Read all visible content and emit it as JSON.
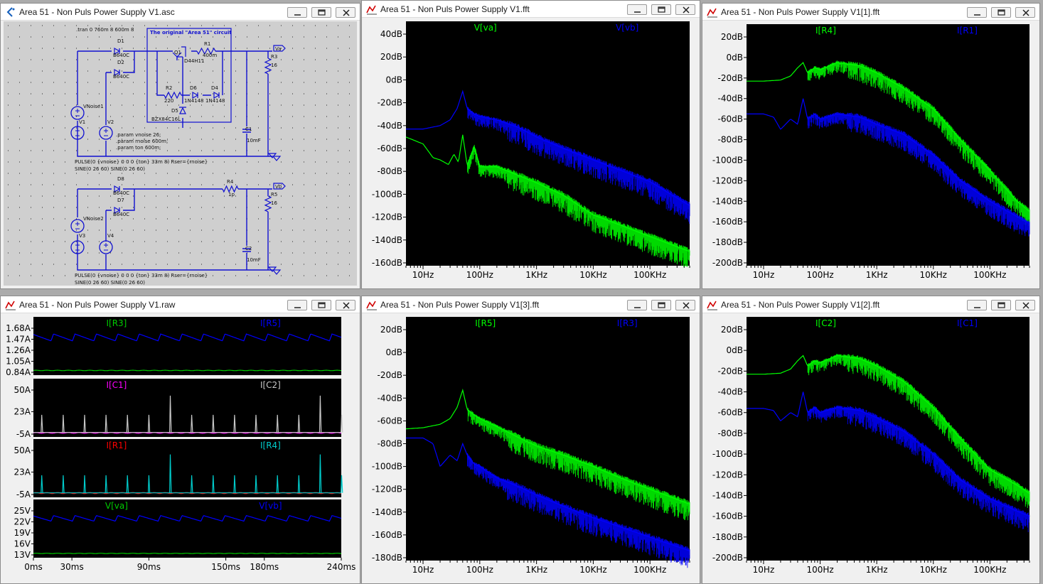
{
  "windows": {
    "schematic": {
      "title": "Area 51 - Non Puls Power Supply V1.asc",
      "directive_tran": ".tran 0 760m 8 600m 8",
      "box_title": "The original \"Area 51\" circuit",
      "params": [
        ".param vnoise 26;",
        ".param rnoise 600m;",
        ".param ton 600m;"
      ],
      "pulse1": "PULSE(0 {vnoise} 0 0 0 {ton} 33m 8) Rser={rnoise}",
      "sine1": "SINE(0 26 60)    SINE(0 26 60)",
      "pulse2": "PULSE(0 {vnoise} 0 0 0 {ton} 33m 8) Rser={rnoise}",
      "sine2": "SINE(0 26 60)    SINE(0 26 60)",
      "labels": {
        "d1": "D1",
        "d1v": "B640C",
        "d2": "D2",
        "d2v": "B640C",
        "q1": "Q1",
        "q1v": "D44H11",
        "r1": "R1",
        "r1v": "400m",
        "r3": "R3",
        "r3v": "16",
        "r2": "R2",
        "r2v": "220",
        "d6": "D6",
        "d6v": "1N4148",
        "d4": "D4",
        "d4v": "1N4148",
        "d5": "D5",
        "d5v": "BZX84C16L",
        "c1": "C1",
        "c1v": "10mF",
        "vnoise1": "VNoise1",
        "v1": "V1",
        "v2": "V2",
        "va": "Va",
        "vb": "Vb",
        "d8": "D8",
        "d8v": "B640C",
        "d7": "D7",
        "d7v": "B640C",
        "r4": "R4",
        "r4v": "1p",
        "r5": "R5",
        "r5v": "16",
        "vnoise2": "VNoise2",
        "v3": "V3",
        "v4": "V4",
        "c2": "C2",
        "c2v": "10mF"
      }
    },
    "fft1": {
      "title": "Area 51 - Non Puls Power Supply V1.fft",
      "chart_data": {
        "type": "line",
        "x_scale": "log",
        "xlim": [
          5,
          500000
        ],
        "ylim": [
          -160,
          40
        ],
        "x_ticks": [
          "10Hz",
          "100Hz",
          "1KHz",
          "10KHz",
          "100KHz"
        ],
        "x_tick_values": [
          10,
          100,
          1000,
          10000,
          100000
        ],
        "y_ticks": [
          "40dB",
          "20dB",
          "0dB",
          "-20dB",
          "-40dB",
          "-60dB",
          "-80dB",
          "-100dB",
          "-120dB",
          "-140dB",
          "-160dB"
        ],
        "y_tick_values": [
          40,
          20,
          0,
          -20,
          -40,
          -60,
          -80,
          -100,
          -120,
          -140,
          -160
        ],
        "series": [
          {
            "name": "V[va]",
            "color": "#00ff00",
            "x": [
              5,
              10,
              15,
              20,
              28,
              35,
              42,
              50,
              60,
              80,
              100,
              200,
              400,
              1000,
              3000,
              10000,
              30000,
              100000,
              500000
            ],
            "y": [
              -50,
              -56,
              -68,
              -70,
              -74,
              -65,
              -72,
              -48,
              -75,
              -58,
              -76,
              -76,
              -82,
              -90,
              -101,
              -118,
              -127,
              -137,
              -150
            ]
          },
          {
            "name": "V[vb]",
            "color": "#0000ff",
            "x": [
              5,
              10,
              20,
              30,
              40,
              50,
              60,
              80,
              100,
              200,
              500,
              1000,
              3000,
              10000,
              30000,
              100000,
              500000
            ],
            "y": [
              -43,
              -43,
              -40,
              -35,
              -25,
              -10,
              -25,
              -30,
              -32,
              -35,
              -42,
              -50,
              -60,
              -70,
              -79,
              -89,
              -110
            ]
          }
        ]
      }
    },
    "fft2": {
      "title": "Area 51 - Non Puls Power Supply V1[1].fft",
      "chart_data": {
        "type": "line",
        "x_scale": "log",
        "xlim": [
          5,
          500000
        ],
        "ylim": [
          -200,
          20
        ],
        "x_ticks": [
          "10Hz",
          "100Hz",
          "1KHz",
          "10KHz",
          "100KHz"
        ],
        "x_tick_values": [
          10,
          100,
          1000,
          10000,
          100000
        ],
        "y_ticks": [
          "20dB",
          "0dB",
          "-20dB",
          "-40dB",
          "-60dB",
          "-80dB",
          "-100dB",
          "-120dB",
          "-140dB",
          "-160dB",
          "-180dB",
          "-200dB"
        ],
        "y_tick_values": [
          20,
          0,
          -20,
          -40,
          -60,
          -80,
          -100,
          -120,
          -140,
          -160,
          -180,
          -200
        ],
        "series": [
          {
            "name": "I[R4]",
            "color": "#00ff00",
            "x": [
              5,
              10,
              20,
              30,
              40,
              50,
              60,
              80,
              100,
              200,
              500,
              1000,
              3000,
              10000,
              30000,
              100000,
              300000,
              500000
            ],
            "y": [
              -23,
              -23,
              -22,
              -18,
              -10,
              -5,
              -15,
              -10,
              -12,
              -5,
              -8,
              -15,
              -30,
              -50,
              -80,
              -110,
              -140,
              -150
            ]
          },
          {
            "name": "I[R1]",
            "color": "#0000ff",
            "x": [
              5,
              10,
              15,
              20,
              30,
              40,
              50,
              60,
              80,
              100,
              200,
              500,
              1000,
              3000,
              10000,
              30000,
              100000,
              300000,
              500000
            ],
            "y": [
              -55,
              -55,
              -58,
              -70,
              -60,
              -65,
              -40,
              -60,
              -55,
              -60,
              -55,
              -58,
              -65,
              -75,
              -95,
              -120,
              -140,
              -155,
              -162
            ]
          }
        ]
      }
    },
    "raw": {
      "title": "Area 51 - Non Puls Power Supply V1.raw",
      "x_ticks": [
        "0ms",
        "30ms",
        "90ms",
        "150ms",
        "180ms",
        "240ms"
      ],
      "x_tick_values": [
        0,
        30,
        90,
        150,
        180,
        240
      ],
      "xlim": [
        0,
        240
      ],
      "panes": [
        {
          "y_ticks": [
            "1.68A",
            "1.47A",
            "1.26A",
            "1.05A",
            "0.84A"
          ],
          "y_tick_values": [
            1.68,
            1.47,
            1.26,
            1.05,
            0.84
          ],
          "ylim": [
            0.84,
            1.68
          ],
          "series": [
            {
              "name": "I[R3]",
              "color": "#00cc00",
              "kind": "flat",
              "base": 0.875,
              "amp": 0.004
            },
            {
              "name": "I[R5]",
              "color": "#0000ff",
              "kind": "saw",
              "high": 1.57,
              "low": 1.44,
              "period_ms": 16.7
            }
          ]
        },
        {
          "y_ticks": [
            "50A",
            "23A",
            "-5A"
          ],
          "y_tick_values": [
            50,
            23,
            -5
          ],
          "ylim": [
            -5,
            50
          ],
          "series": [
            {
              "name": "I[C1]",
              "color": "#ff00ff",
              "kind": "flat",
              "base": -3.5,
              "amp": 0.5
            },
            {
              "name": "I[C2]",
              "color": "#c8c8c8",
              "kind": "spike",
              "base": -3,
              "peak": 19,
              "period_ms": 16.7,
              "max_spike": 43
            }
          ]
        },
        {
          "y_ticks": [
            "50A",
            "23A",
            "-5A"
          ],
          "y_tick_values": [
            50,
            23,
            -5
          ],
          "ylim": [
            -5,
            50
          ],
          "series": [
            {
              "name": "I[R1]",
              "color": "#ff0000",
              "kind": "flat",
              "base": -3.2,
              "amp": 0.6
            },
            {
              "name": "I[R4]",
              "color": "#00cccc",
              "kind": "spike",
              "base": -3,
              "peak": 19,
              "period_ms": 16.7,
              "max_spike": 45
            }
          ]
        },
        {
          "y_ticks": [
            "25V",
            "22V",
            "19V",
            "16V",
            "13V"
          ],
          "y_tick_values": [
            25,
            22,
            19,
            16,
            13
          ],
          "ylim": [
            13,
            25
          ],
          "series": [
            {
              "name": "V[va]",
              "color": "#00cc00",
              "kind": "flat",
              "base": 13.4,
              "amp": 0.05
            },
            {
              "name": "V[vb]",
              "color": "#0000ff",
              "kind": "saw",
              "high": 23.7,
              "low": 22.2,
              "period_ms": 16.7
            }
          ]
        }
      ]
    },
    "fft3": {
      "title": "Area 51 - Non Puls Power Supply V1[3].fft",
      "chart_data": {
        "type": "line",
        "x_scale": "log",
        "xlim": [
          5,
          500000
        ],
        "ylim": [
          -180,
          20
        ],
        "x_ticks": [
          "10Hz",
          "100Hz",
          "1KHz",
          "10KHz",
          "100KHz"
        ],
        "x_tick_values": [
          10,
          100,
          1000,
          10000,
          100000
        ],
        "y_ticks": [
          "20dB",
          "0dB",
          "-20dB",
          "-40dB",
          "-60dB",
          "-80dB",
          "-100dB",
          "-120dB",
          "-140dB",
          "-160dB",
          "-180dB"
        ],
        "y_tick_values": [
          20,
          0,
          -20,
          -40,
          -60,
          -80,
          -100,
          -120,
          -140,
          -160,
          -180
        ],
        "series": [
          {
            "name": "I[R5]",
            "color": "#00ff00",
            "x": [
              5,
              10,
              20,
              30,
              40,
              50,
              60,
              80,
              100,
              200,
              500,
              1000,
              3000,
              10000,
              30000,
              100000,
              500000
            ],
            "y": [
              -67,
              -66,
              -63,
              -58,
              -48,
              -33,
              -50,
              -55,
              -58,
              -65,
              -75,
              -82,
              -90,
              -100,
              -110,
              -120,
              -133
            ]
          },
          {
            "name": "I[R3]",
            "color": "#0000ff",
            "x": [
              5,
              10,
              15,
              20,
              30,
              40,
              50,
              60,
              80,
              100,
              200,
              500,
              1000,
              3000,
              10000,
              30000,
              100000,
              500000
            ],
            "y": [
              -75,
              -75,
              -80,
              -100,
              -90,
              -95,
              -80,
              -90,
              -98,
              -100,
              -110,
              -118,
              -125,
              -135,
              -145,
              -153,
              -162,
              -174
            ]
          }
        ]
      }
    },
    "fft4": {
      "title": "Area 51 - Non Puls Power Supply V1[2].fft",
      "chart_data": {
        "type": "line",
        "x_scale": "log",
        "xlim": [
          5,
          500000
        ],
        "ylim": [
          -200,
          20
        ],
        "x_ticks": [
          "10Hz",
          "100Hz",
          "1KHz",
          "10KHz",
          "100KHz"
        ],
        "x_tick_values": [
          10,
          100,
          1000,
          10000,
          100000
        ],
        "y_ticks": [
          "20dB",
          "0dB",
          "-20dB",
          "-40dB",
          "-60dB",
          "-80dB",
          "-100dB",
          "-120dB",
          "-140dB",
          "-160dB",
          "-180dB",
          "-200dB"
        ],
        "y_tick_values": [
          20,
          0,
          -20,
          -40,
          -60,
          -80,
          -100,
          -120,
          -140,
          -160,
          -180,
          -200
        ],
        "series": [
          {
            "name": "I[C2]",
            "color": "#00ff00",
            "x": [
              5,
              10,
              20,
              30,
              40,
              50,
              60,
              80,
              100,
              200,
              500,
              1000,
              3000,
              10000,
              30000,
              100000,
              300000,
              500000
            ],
            "y": [
              -23,
              -23,
              -22,
              -18,
              -10,
              -5,
              -15,
              -10,
              -12,
              -5,
              -8,
              -15,
              -30,
              -55,
              -85,
              -115,
              -130,
              -138
            ]
          },
          {
            "name": "I[C1]",
            "color": "#0000ff",
            "x": [
              5,
              10,
              15,
              20,
              30,
              40,
              50,
              60,
              80,
              100,
              200,
              500,
              1000,
              3000,
              10000,
              30000,
              100000,
              300000,
              500000
            ],
            "y": [
              -56,
              -56,
              -58,
              -68,
              -60,
              -64,
              -40,
              -60,
              -55,
              -60,
              -55,
              -58,
              -65,
              -78,
              -100,
              -125,
              -143,
              -155,
              -160
            ]
          }
        ]
      }
    }
  }
}
